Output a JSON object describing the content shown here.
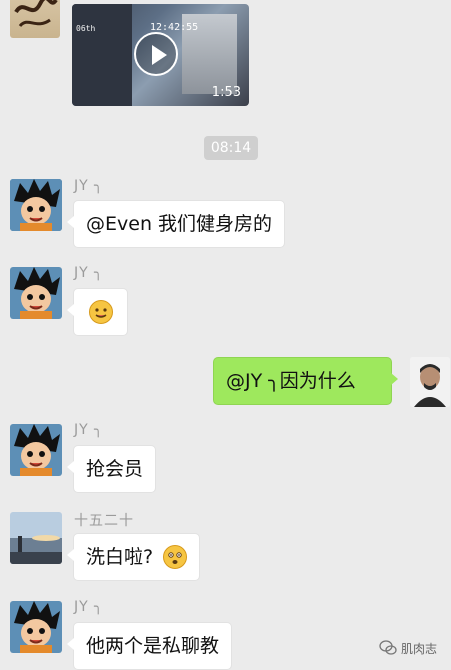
{
  "video": {
    "timestamp": "12:42:55",
    "top_left_text": "06th",
    "duration": "1:53",
    "play_icon": "play-icon"
  },
  "time_divider": "08:14",
  "messages": [
    {
      "sender": "JY ╮",
      "text": "@Even 我们健身房的"
    },
    {
      "sender": "JY ╮",
      "emoji": "face-with-tongue-emoji"
    },
    {
      "side": "right",
      "text": "@JY ╮因为什么"
    },
    {
      "sender": "JY ╮",
      "text": "抢会员"
    },
    {
      "sender": "十五二十",
      "text": "洗白啦?",
      "emoji": "surprised-face-emoji"
    },
    {
      "sender": "JY ╮",
      "text": "他两个是私聊教"
    }
  ],
  "watermark": {
    "text": "肌肉志",
    "icon": "wechat-icon"
  },
  "colors": {
    "background": "#ebebeb",
    "bubble_left": "#ffffff",
    "bubble_right": "#9ee85d",
    "time_pill": "#cfcfcf"
  }
}
